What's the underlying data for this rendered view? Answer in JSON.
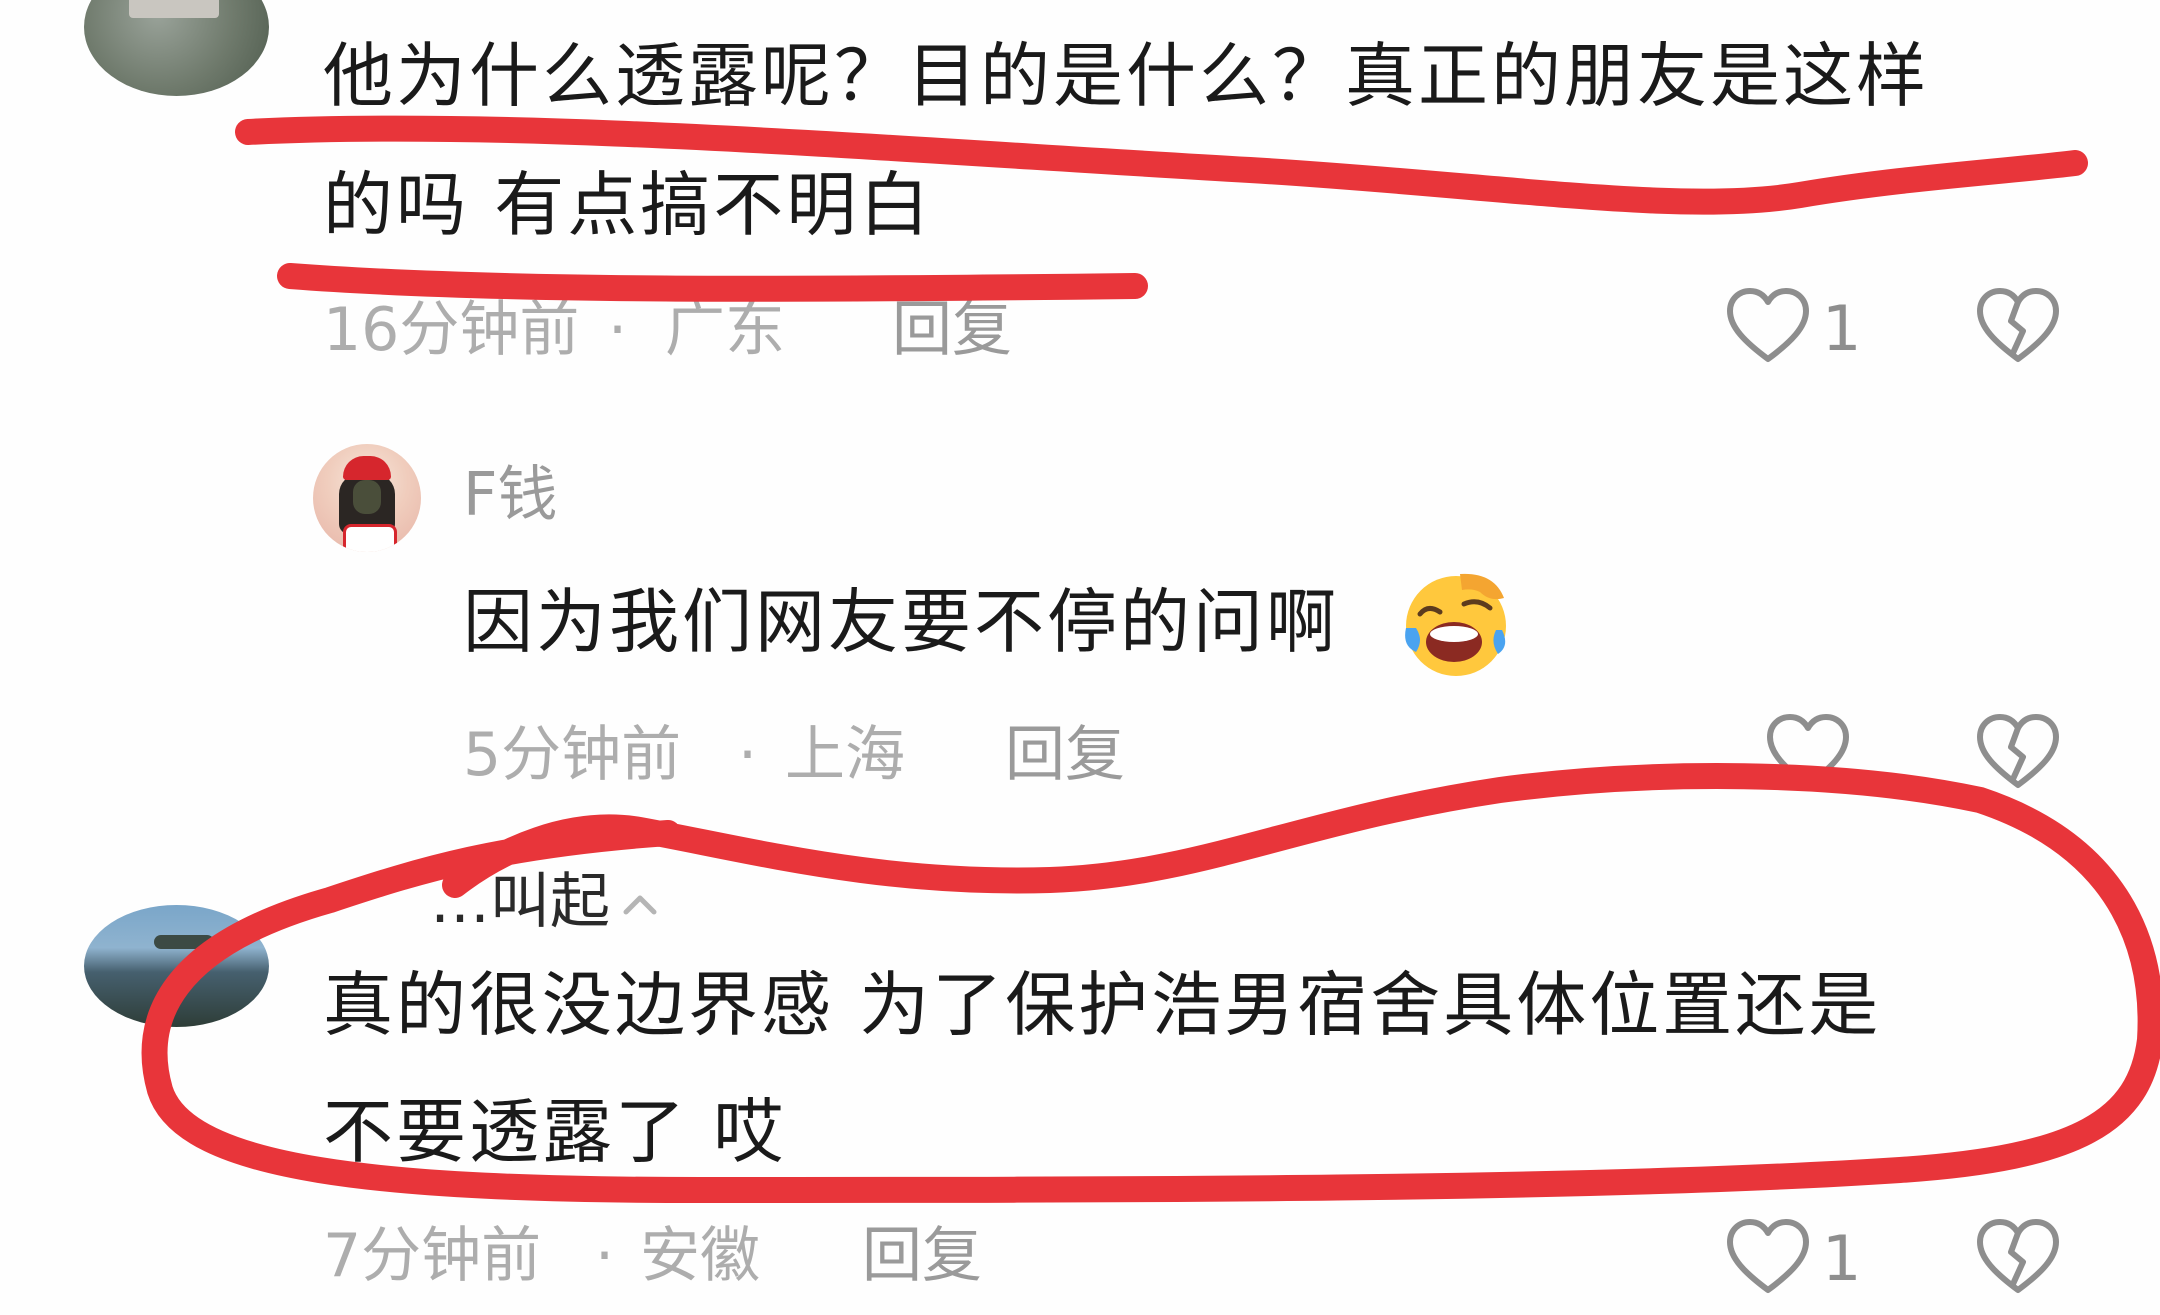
{
  "comments": [
    {
      "text_line1": "他为什么透露呢？目的是什么？真正的朋友是这样",
      "text_line2": "的吗  有点搞不明白",
      "time": "16分钟前",
      "location": "广东",
      "reply_label": "回复",
      "like_count": "1"
    },
    {
      "username": "F钱",
      "text": "因为我们网友要不停的问啊",
      "emoji": "laughing-crying-emoji",
      "time": "5分钟前",
      "location": "上海",
      "reply_label": "回复"
    },
    {
      "username_partial": "…叫起",
      "text_line1": "真的很没边界感  为了保护浩男宿舍具体位置还是",
      "text_line2": "不要透露了 哎",
      "time": "7分钟前",
      "location": "安徽",
      "reply_label": "回复",
      "like_count": "1"
    }
  ],
  "separator": "·",
  "icons": {
    "like": "heart-outline-icon",
    "dislike": "broken-heart-icon",
    "badge": "chevron-up-icon"
  },
  "colors": {
    "annotation": "#e8353a",
    "meta_text": "#adadad",
    "body_text": "#1a1a1a"
  }
}
